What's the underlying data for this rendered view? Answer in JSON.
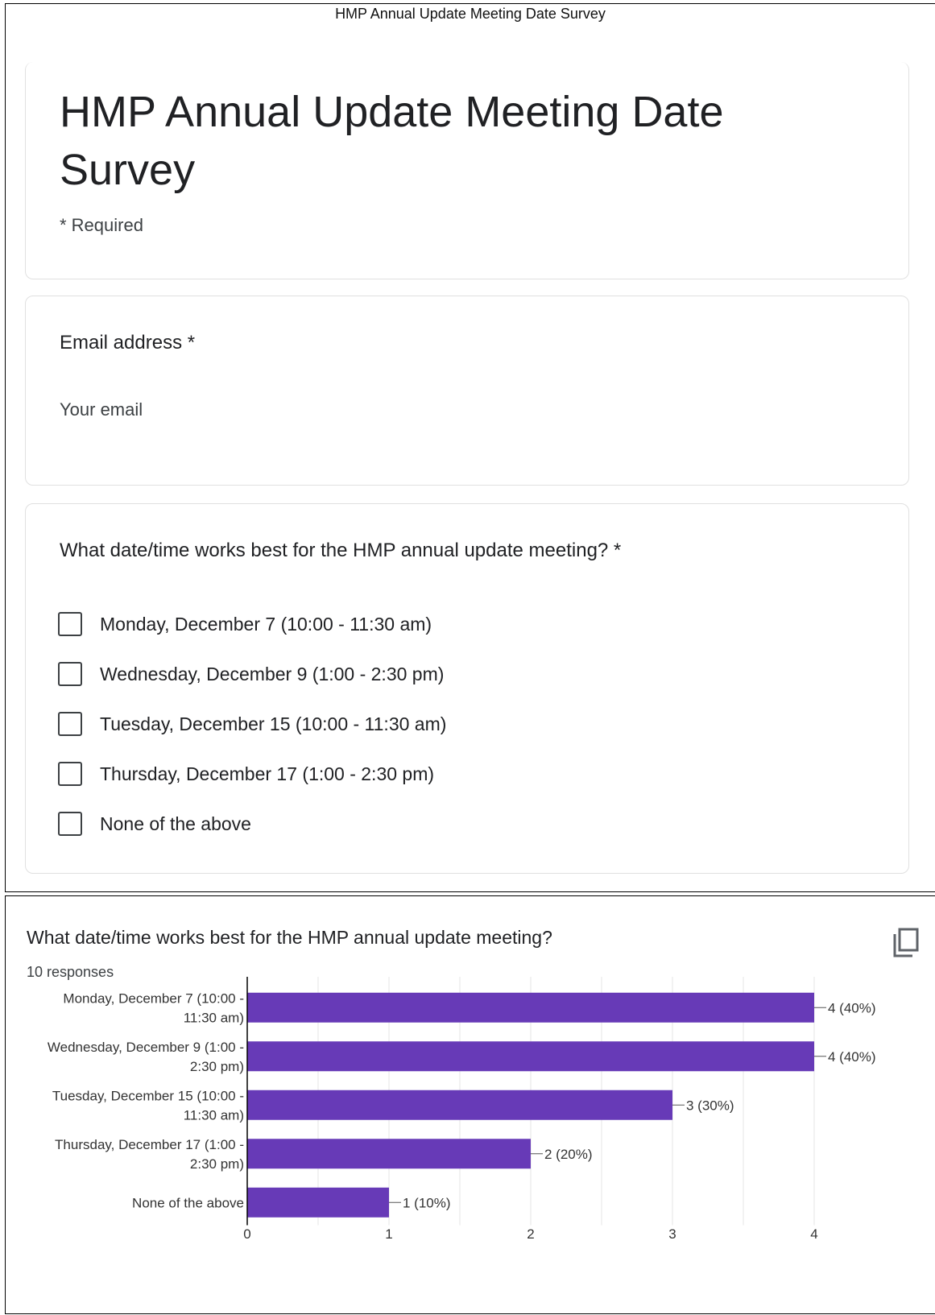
{
  "window_title": "HMP Annual Update Meeting Date Survey",
  "form": {
    "title": "HMP Annual Update Meeting Date Survey",
    "required_note": "* Required",
    "email_question": "Email address *",
    "email_placeholder": "Your email",
    "question": "What date/time works best for the HMP annual update meeting? *",
    "options": [
      "Monday, December 7 (10:00 - 11:30 am)",
      "Wednesday, December 9 (1:00 - 2:30 pm)",
      "Tuesday, December 15 (10:00 - 11:30 am)",
      "Thursday, December 17 (1:00 - 2:30 pm)",
      "None of the above"
    ]
  },
  "results": {
    "question": "What date/time works best for the HMP annual update meeting?",
    "responses": "10 responses",
    "copy_icon": "copy-icon"
  },
  "colors": {
    "bar": "#673ab7",
    "grid": "#e6e6e6",
    "axis": "#000000"
  },
  "chart_data": {
    "type": "bar",
    "orientation": "horizontal",
    "title": "What date/time works best for the HMP annual update meeting?",
    "categories": [
      [
        "Monday, December 7 (10:00 -",
        "11:30 am)"
      ],
      [
        "Wednesday, December 9 (1:00 -",
        "2:30 pm)"
      ],
      [
        "Tuesday, December 15 (10:00 -",
        "11:30 am)"
      ],
      [
        "Thursday, December 17 (1:00 -",
        "2:30 pm)"
      ],
      [
        "None of the above"
      ]
    ],
    "values": [
      4,
      4,
      3,
      2,
      1
    ],
    "data_labels": [
      "4 (40%)",
      "4 (40%)",
      "3 (30%)",
      "2 (20%)",
      "1 (10%)"
    ],
    "xticks": [
      "0",
      "1",
      "2",
      "3",
      "4"
    ],
    "xlim": [
      0,
      4
    ],
    "grid": true
  }
}
